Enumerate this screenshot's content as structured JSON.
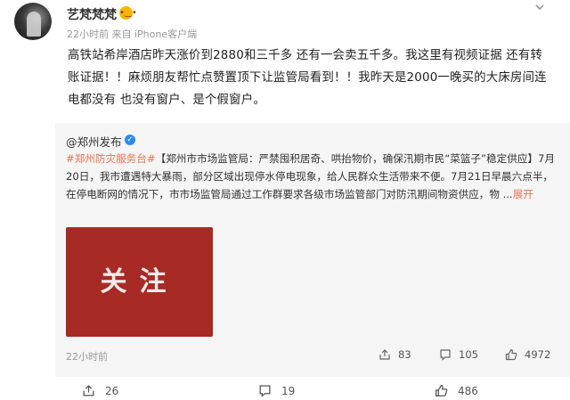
{
  "post": {
    "username": "艺梵梵梵",
    "emoji": "😮",
    "meta": "22小时前  来自 iPhone客户端",
    "text": "高铁站希岸酒店昨天涨价到2880和三千多 还有一会卖五千多。我这里有视频证据 还有转账证据！！麻烦朋友帮忙点赞置顶下让监管局看到！！我昨天是2000一晚买的大床房间连电都没有 也没有窗户、是个假窗户。"
  },
  "repost": {
    "author": "@郑州发布",
    "text_tag": "#郑州防灾服务台#",
    "text_body": "【郑州市市场监管局：严禁囤积居奇、哄抬物价，确保汛期市民“菜篮子”稳定供应】7月20日，我市遭遇特大暴雨，部分区域出现停水停电现象，给人民群众生活带来不便。7月21日早晨六点半，在停电断网的情况下，市市场监管局通过工作群要求各级市场监管部门对防汛期间物资供应，物 ...",
    "expand_label": "展开",
    "image_text": "关注",
    "time": "22小时前",
    "stats": {
      "reposts": "83",
      "comments": "105",
      "likes": "4972"
    }
  },
  "actions": {
    "reposts": "26",
    "comments": "19",
    "likes": "486"
  },
  "colors": {
    "link": "#eb7350",
    "verified": "#2a8bf2",
    "image_bg": "#a82a25",
    "repost_bg": "#f5f5f5"
  },
  "icons": [
    "more-icon",
    "verified-icon",
    "repost-icon",
    "comment-icon",
    "like-icon"
  ]
}
